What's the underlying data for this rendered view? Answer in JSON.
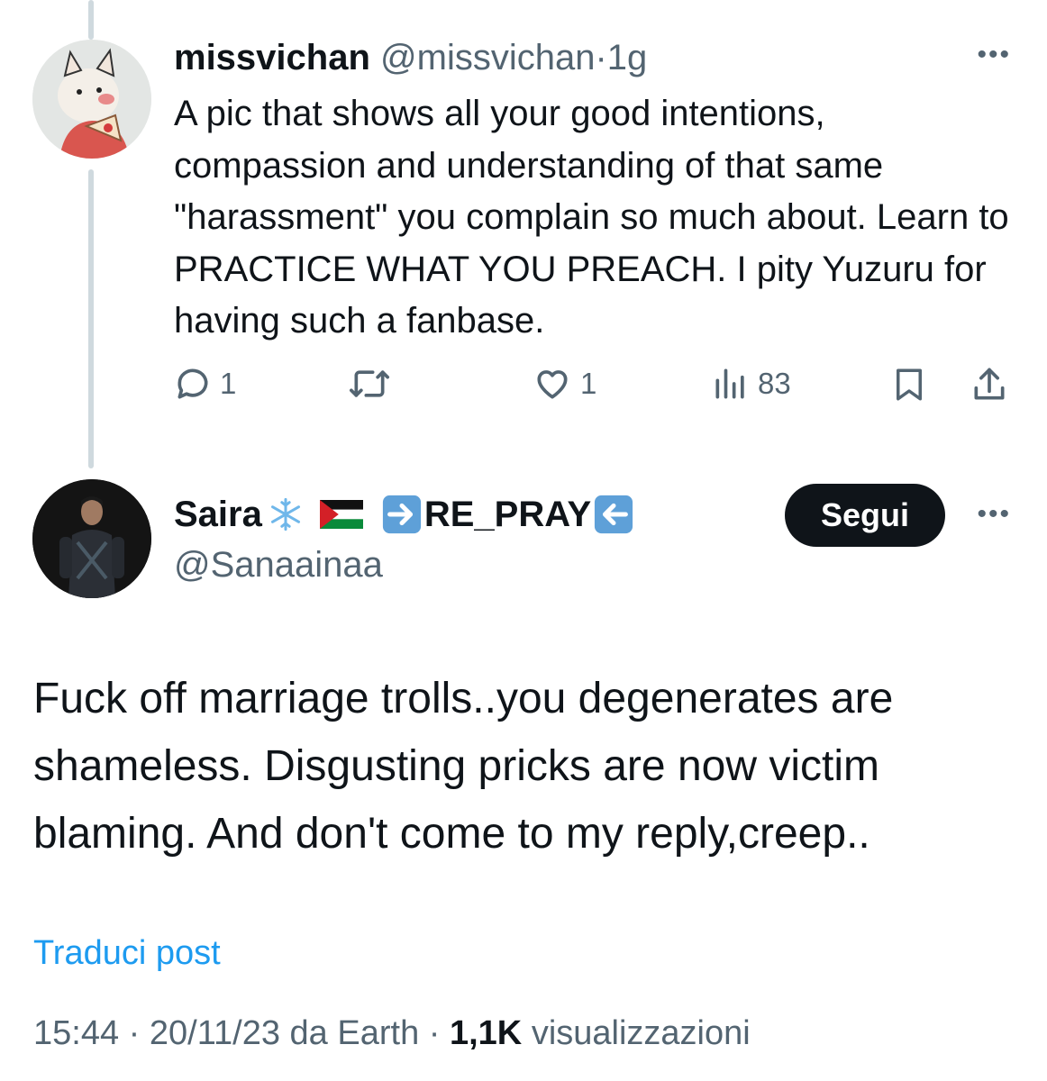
{
  "reply_tweet": {
    "display_name": "missvichan",
    "handle": "@missvichan",
    "separator": "·",
    "time": "1g",
    "text": "A pic that shows all your good intentions, compassion and understanding of that same \"harassment\" you complain so much about. Learn to PRACTICE WHAT YOU PREACH. I pity Yuzuru for having such a fanbase.",
    "more_label": "•••",
    "actions": {
      "reply_count": "1",
      "repost_count": "",
      "like_count": "1",
      "views_count": "83"
    }
  },
  "main_tweet": {
    "display_name": "Saira",
    "name_suffix": "RE_PRAY",
    "handle": "@Sanaainaa",
    "follow_label": "Segui",
    "more_label": "•••",
    "text": "Fuck off marriage trolls..you degenerates are shameless. Disgusting pricks are now victim blaming. And don't come to my reply,creep..",
    "translate_label": "Traduci post",
    "time": "15:44",
    "date": "20/11/23",
    "source": "da Earth",
    "sep": "·",
    "views_count": "1,1K",
    "views_label": "visualizzazioni"
  },
  "colors": {
    "text": "#0f1419",
    "muted": "#536471",
    "link": "#1d9bf0",
    "thread_line": "#cfd9de"
  },
  "icons": [
    "reply-icon",
    "repost-icon",
    "like-icon",
    "views-icon",
    "bookmark-icon",
    "share-icon",
    "snowflake-icon",
    "palestine-flag-icon",
    "arrow-right-icon",
    "arrow-left-icon"
  ]
}
